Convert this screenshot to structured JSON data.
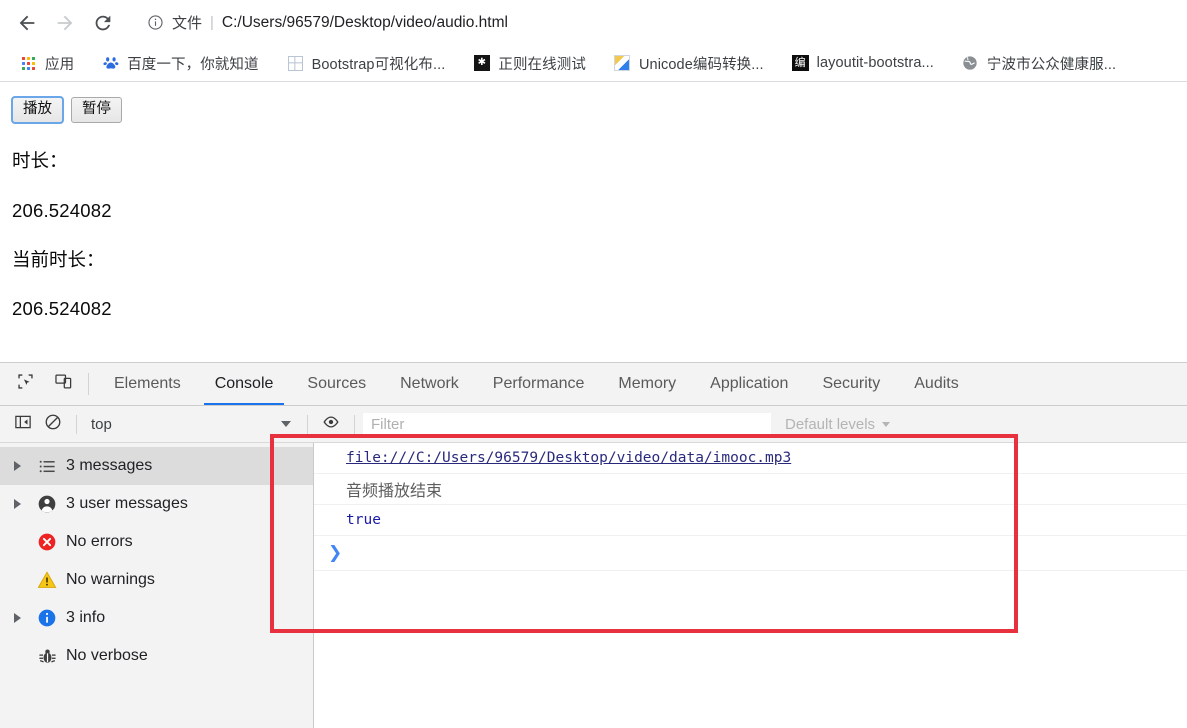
{
  "browser": {
    "nav": {
      "back_icon": "arrow-left-icon",
      "forward_icon": "arrow-right-icon",
      "reload_icon": "reload-icon"
    },
    "omnibox": {
      "info_icon": "info-circle-icon",
      "scheme_label": "文件",
      "separator": "|",
      "url": "C:/Users/96579/Desktop/video/audio.html"
    },
    "bookmarks": [
      {
        "label": "应用",
        "icon": "apps-grid-icon"
      },
      {
        "label": "百度一下，你就知道",
        "icon": "baidu-icon"
      },
      {
        "label": "Bootstrap可视化布...",
        "icon": "grid-four-icon"
      },
      {
        "label": "正则在线测试",
        "icon": "regex-dark-icon"
      },
      {
        "label": "Unicode编码转换...",
        "icon": "unicode-icon"
      },
      {
        "label": "layoutit-bootstra...",
        "icon": "bian-square-icon"
      },
      {
        "label": "宁波市公众健康服...",
        "icon": "globe-icon"
      }
    ]
  },
  "page": {
    "buttons": [
      {
        "label": "播放",
        "focused": true
      },
      {
        "label": "暂停",
        "focused": false
      }
    ],
    "duration_label": "时长：",
    "duration_value": "206.524082",
    "current_label": "当前时长：",
    "current_value": "206.524082"
  },
  "devtools": {
    "toolbar_icons": {
      "inspect": "inspect-cursor-icon",
      "device": "device-toggle-icon"
    },
    "tabs": [
      {
        "label": "Elements",
        "active": false
      },
      {
        "label": "Console",
        "active": true
      },
      {
        "label": "Sources",
        "active": false
      },
      {
        "label": "Network",
        "active": false
      },
      {
        "label": "Performance",
        "active": false
      },
      {
        "label": "Memory",
        "active": false
      },
      {
        "label": "Application",
        "active": false
      },
      {
        "label": "Security",
        "active": false
      },
      {
        "label": "Audits",
        "active": false
      }
    ],
    "filterbar": {
      "sidebar_toggle_icon": "show-console-sidebar-icon",
      "clear_icon": "clear-console-icon",
      "context": "top",
      "eye_icon": "live-expression-icon",
      "filter_placeholder": "Filter",
      "filter_value": "",
      "levels_label": "Default levels"
    },
    "sidebar": [
      {
        "label": "3 messages",
        "icon": "list-icon",
        "expandable": true,
        "selected": true
      },
      {
        "label": "3 user messages",
        "icon": "user-icon",
        "expandable": true,
        "selected": false
      },
      {
        "label": "No errors",
        "icon": "error-icon",
        "expandable": false,
        "selected": false
      },
      {
        "label": "No warnings",
        "icon": "warning-icon",
        "expandable": false,
        "selected": false
      },
      {
        "label": "3 info",
        "icon": "info-icon",
        "expandable": true,
        "selected": false
      },
      {
        "label": "No verbose",
        "icon": "bug-icon",
        "expandable": false,
        "selected": false
      }
    ],
    "messages": [
      {
        "text": "file:///C:/Users/96579/Desktop/video/data/imooc.mp3",
        "kind": "link"
      },
      {
        "text": "音频播放结束",
        "kind": "text-cn"
      },
      {
        "text": "true",
        "kind": "boolean"
      }
    ],
    "prompt_caret": "❯"
  },
  "annotation": {
    "name": "red-highlight-rectangle",
    "color": "#e8313f"
  }
}
